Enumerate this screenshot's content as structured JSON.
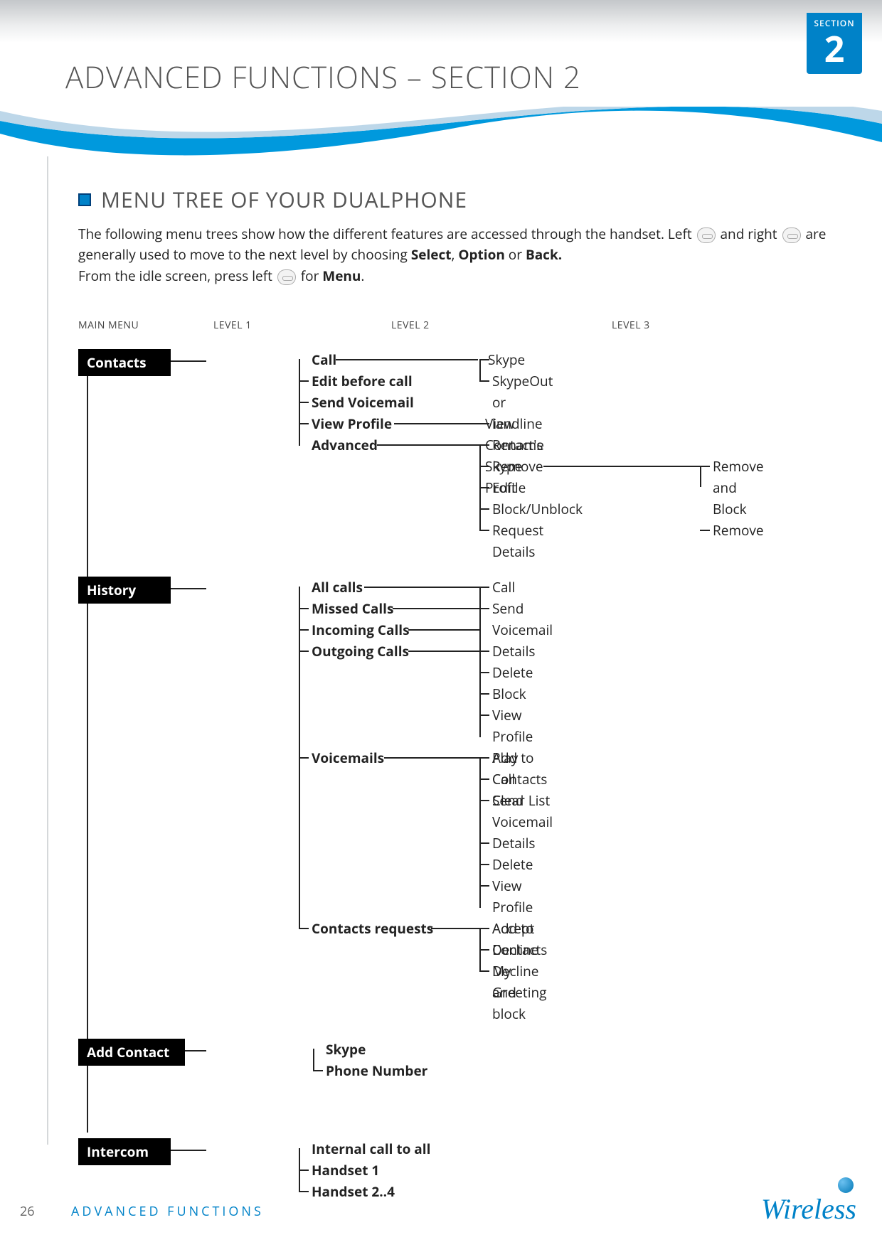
{
  "section_tag": {
    "label": "SECTION",
    "number": "2"
  },
  "page_title": "ADVANCED FUNCTIONS – SECTION 2",
  "subheading": "MENU TREE OF YOUR DUALPHONE",
  "intro": {
    "p1a": "The following menu trees show how the different features are accessed through the handset. Left ",
    "p1b": " and right ",
    "p1c": " are generally used to move to the next level by choosing ",
    "select": "Select",
    "comma1": ", ",
    "option": "Option",
    "or": " or ",
    "back": "Back.",
    "p2a": "From the idle screen, press left ",
    "p2b": " for ",
    "menu": "Menu",
    "period": "."
  },
  "columns": [
    "MAIN MENU",
    "LEVEL 1",
    "LEVEL 2",
    "LEVEL 3"
  ],
  "menu": {
    "contacts": {
      "label": "Contacts",
      "level1": [
        "Call",
        "Edit before call",
        "Send Voicemail",
        "View Profile",
        "Advanced"
      ],
      "call_children": [
        "Skype",
        "SkypeOut or landline"
      ],
      "view_profile_children": [
        "View Contact's Skype Profile"
      ],
      "advanced_children": [
        "Rename",
        "Remove",
        "Edit",
        "Block/Unblock",
        "Request Details"
      ],
      "remove_children": [
        "Remove and Block",
        "Remove"
      ]
    },
    "history": {
      "label": "History",
      "level1": [
        "All calls",
        "Missed Calls",
        "Incoming Calls",
        "Outgoing Calls",
        "Voicemails",
        "Contacts requests"
      ],
      "calls_children": [
        "Call",
        "Send Voicemail",
        "Details",
        "Delete",
        "Block",
        "View Profile",
        "Add to Contacts",
        "Clear List"
      ],
      "voicemails_children": [
        "Play",
        "Call",
        "Send Voicemail",
        "Details",
        "Delete",
        "View Profile",
        "Add to Contacts",
        "My Greeting"
      ],
      "requests_children": [
        "Accept",
        "Decline",
        "Decline and block"
      ]
    },
    "add_contact": {
      "label": "Add Contact",
      "level1": [
        "Skype",
        "Phone Number"
      ]
    },
    "intercom": {
      "label": "Intercom",
      "level1": [
        "Internal call to all",
        "Handset 1",
        "Handset 2..4"
      ]
    }
  },
  "footer": {
    "page": "26",
    "text": "ADVANCED FUNCTIONS",
    "brand": "Wireless"
  }
}
